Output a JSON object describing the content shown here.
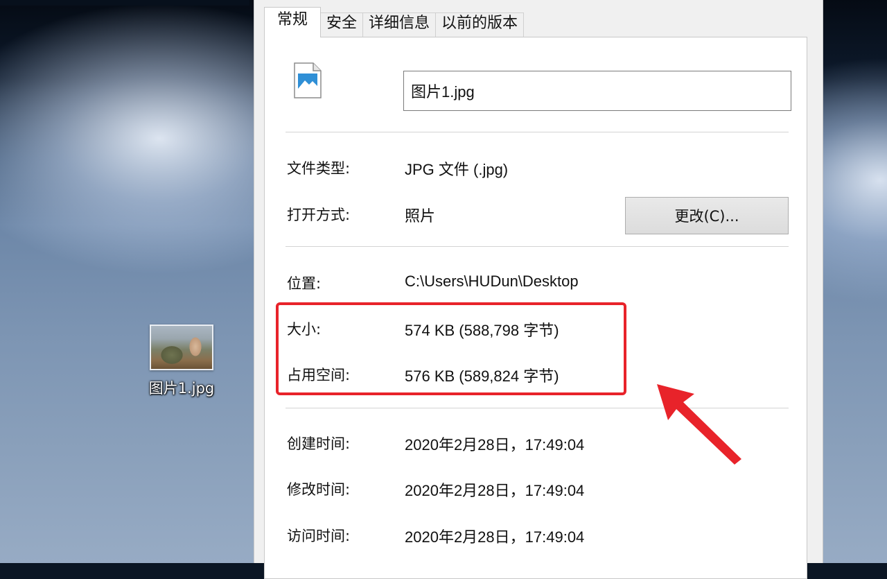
{
  "desktop": {
    "icon_label": "图片1.jpg"
  },
  "window": {
    "tabs": [
      {
        "label": "常规",
        "active": true
      },
      {
        "label": "安全",
        "active": false
      },
      {
        "label": "详细信息",
        "active": false
      },
      {
        "label": "以前的版本",
        "active": false
      }
    ],
    "file_name": "图片1.jpg",
    "file_type": {
      "label": "文件类型:",
      "value": "JPG 文件 (.jpg)"
    },
    "open_with": {
      "label": "打开方式:",
      "value": "照片",
      "button": "更改(C)..."
    },
    "location": {
      "label": "位置:",
      "value": "C:\\Users\\HUDun\\Desktop"
    },
    "size": {
      "label": "大小:",
      "value": "574 KB (588,798 字节)"
    },
    "size_on_disk": {
      "label": "占用空间:",
      "value": "576 KB (589,824 字节)"
    },
    "created": {
      "label": "创建时间:",
      "value": "2020年2月28日，17:49:04"
    },
    "modified": {
      "label": "修改时间:",
      "value": "2020年2月28日，17:49:04"
    },
    "accessed": {
      "label": "访问时间:",
      "value": "2020年2月28日，17:49:04"
    }
  },
  "colors": {
    "highlight": "#e8232a"
  }
}
